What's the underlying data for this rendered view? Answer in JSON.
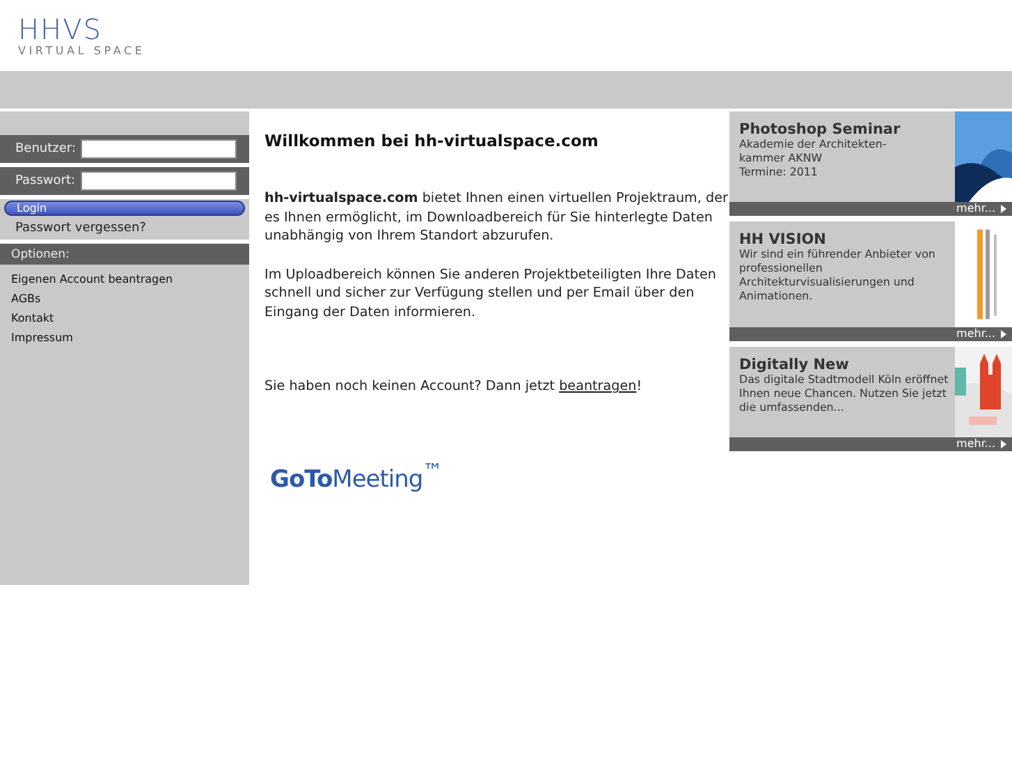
{
  "logo": {
    "mark": "HHVS",
    "tagline": "VIRTUAL SPACE"
  },
  "login": {
    "fields": [
      {
        "label": "Benutzer:"
      },
      {
        "label": "Passwort:"
      }
    ],
    "button": "Login",
    "forgot": "Passwort vergessen?"
  },
  "options": {
    "title": "Optionen:",
    "links": [
      "Eigenen Account beantragen",
      "AGBs",
      "Kontakt",
      "Impressum"
    ]
  },
  "main": {
    "title": "Willkommen bei hh-virtualspace.com",
    "paragraphs": [
      "**hh-virtualspace.com** bietet Ihnen einen virtuellen Projektraum, der es Ihnen ermöglicht, im Downloadbereich für Sie hinterlegte Daten unabhängig von Ihrem Standort abzurufen.",
      "Im Uploadbereich können Sie anderen Projektbeteiligten Ihre Daten schnell und sicher zur Verfügung stellen und per Email über den Eingang der Daten informieren."
    ],
    "signup_text": "Sie haben noch keinen Account? Dann jetzt",
    "signup_link": "beantragen",
    "signup_end": "!",
    "partner_logo": "**GoTo**Meeting$^{™}$"
  },
  "news": [
    {
      "title": "Photoshop Seminar",
      "text": "Akademie der Architekten-\nkammer AKNW\nTermine: 2011",
      "more": "mehr...",
      "kind": "picture"
    },
    {
      "title": "HH VISION",
      "text": "Wir sind ein führender Anbieter von professionellen Architekturvisualisierungen und Animationen.",
      "more": "mehr...",
      "kind": "picture"
    },
    {
      "title": "Digitally New",
      "text": "Das digitale Stadtmodell Köln eröffnet Ihnen neue Chancen. Nutzen Sie jetzt die umfassenden...",
      "more": "mehr...",
      "kind": "picture"
    }
  ]
}
